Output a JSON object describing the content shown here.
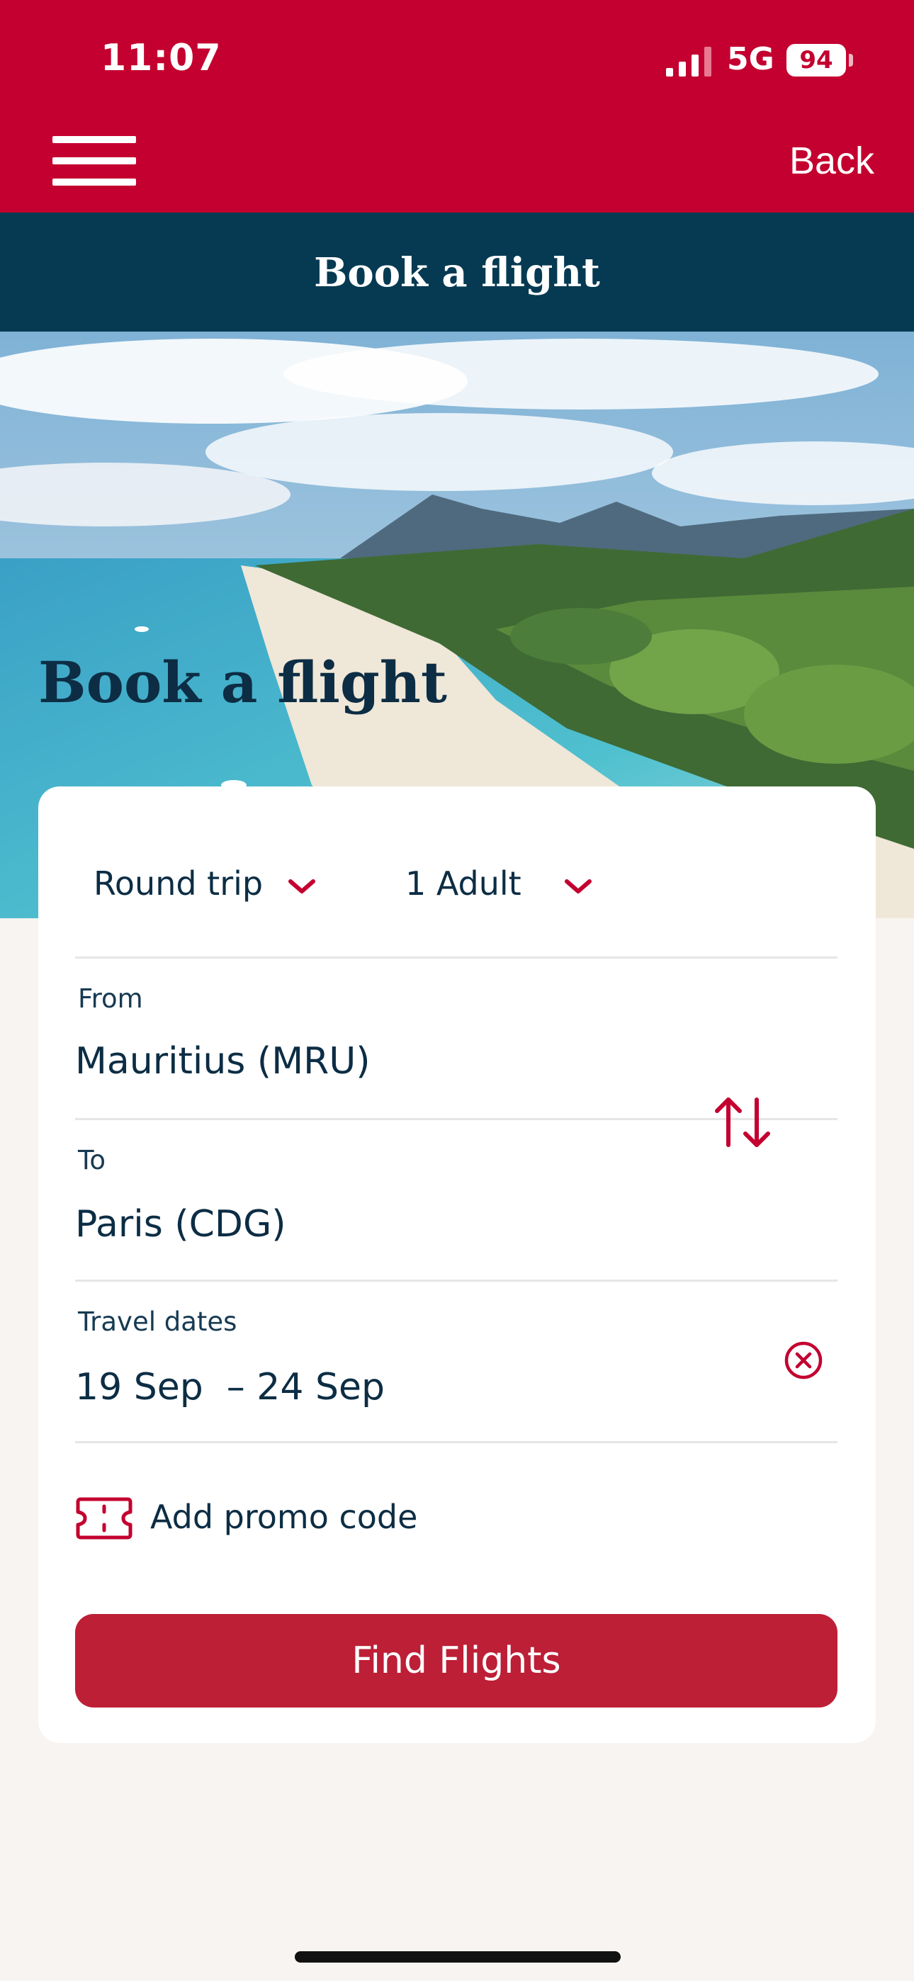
{
  "status_bar": {
    "time": "11:07",
    "network": "5G",
    "battery": "94"
  },
  "nav": {
    "back_label": "Back"
  },
  "header": {
    "title": "Book a flight"
  },
  "hero": {
    "title": "Book a flight"
  },
  "form": {
    "trip_type": "Round trip",
    "passengers": "1 Adult",
    "from_label": "From",
    "from_value": "Mauritius (MRU)",
    "to_label": "To",
    "to_value": "Paris (CDG)",
    "dates_label": "Travel dates",
    "dates_value": "19 Sep  – 24 Sep",
    "promo_label": "Add promo code",
    "submit_label": "Find Flights"
  },
  "colors": {
    "brand_red": "#c3002f",
    "header_navy": "#053a52",
    "button_red": "#bd1f36",
    "text_navy": "#0c2d44"
  },
  "icons": [
    "menu-icon",
    "chevron-down-icon",
    "swap-icon",
    "clear-icon",
    "ticket-icon"
  ]
}
